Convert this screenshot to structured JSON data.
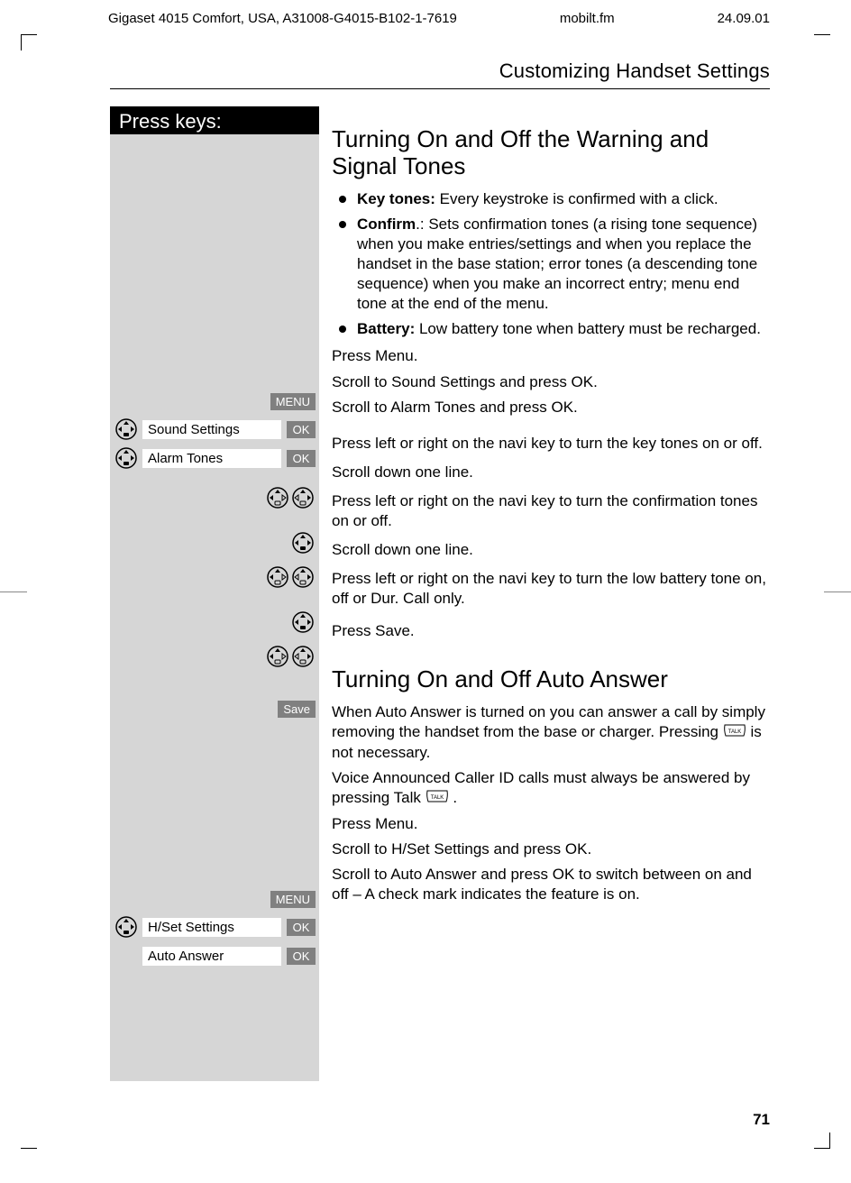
{
  "header": {
    "left": "Gigaset 4015 Comfort, USA, A31008-G4015-B102-1-7619",
    "center": "mobilt.fm",
    "right": "24.09.01"
  },
  "section_title": "Customizing Handset Settings",
  "press_keys": "Press keys:",
  "h1": "Turning On and Off the Warning and Signal Tones",
  "bullets": {
    "b1_bold": "Key tones:",
    "b1_rest": " Every keystroke is confirmed with a click.",
    "b2_bold": "Confirm",
    "b2_rest": ".: Sets confirmation tones (a rising tone sequence) when you make entries/settings and when you replace the handset in the base station; error tones (a descending tone sequence) when you make an incorrect entry; menu end tone at the end of the menu.",
    "b3_bold": "Battery:",
    "b3_rest": " Low battery tone when battery must be recharged."
  },
  "sidebar": {
    "menu": "MENU",
    "ok": "OK",
    "save": "Save",
    "sound_settings": "Sound Settings",
    "alarm_tones": "Alarm Tones",
    "hset": "H/Set Settings",
    "auto_answer": "Auto Answer"
  },
  "steps": {
    "s1": "Press Menu.",
    "s2": "Scroll to Sound Settings and press OK.",
    "s3": "Scroll to Alarm Tones and press OK.",
    "s4": "Press left or right on the navi key to turn the key tones on or off.",
    "s5": "Scroll down one line.",
    "s6": "Press left or right on the navi key to turn the confirmation tones on or off.",
    "s7": "Scroll down one line.",
    "s8": "Press left or right on the navi key to turn the low battery tone on, off or Dur. Call only.",
    "s9": "Press Save."
  },
  "h2": "Turning On and Off Auto Answer",
  "auto": {
    "p1a": "When Auto Answer is turned on you can answer a call by simply removing the handset from the base or charger.  Pressing ",
    "p1b": " is not necessary.",
    "p2a": "Voice Announced Caller ID calls must always be answered by pressing Talk ",
    "p2b": " .",
    "s1": "Press Menu.",
    "s2": "Scroll to H/Set Settings and press OK.",
    "s3": "Scroll to Auto Answer and press OK to switch between on and off – A check mark indicates the feature is on."
  },
  "page_number": "71"
}
